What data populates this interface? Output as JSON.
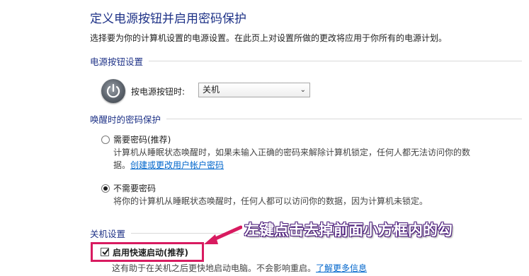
{
  "page": {
    "title": "定义电源按钮并启用密码保护",
    "description": "选择要为你的计算机设置的电源设置。在此页上对设置所做的更改将应用于你所有的电源计划。"
  },
  "power_button_section": {
    "heading": "电源按钮设置",
    "field_label": "按电源按钮时:",
    "selected_value": "关机",
    "icon": "power-icon"
  },
  "password_section": {
    "heading": "唤醒时的密码保护",
    "option_require": {
      "label": "需要密码(推荐)",
      "desc_line1": "计算机从睡眠状态唤醒时，如果未输入正确的密码来解除计算机锁定，任何人都无法访问你的数",
      "desc_line2_prefix": "据。",
      "link": "创建或更改用户帐户密码",
      "checked": false
    },
    "option_no_require": {
      "label": "不需要密码",
      "desc": "将你的计算机从睡眠状态唤醒时，任何人都可以访问你的数据，因为计算机未锁定。",
      "checked": true
    }
  },
  "shutdown_section": {
    "heading": "关机设置",
    "fast_startup": {
      "label": "启用快速启动(推荐)",
      "checked": true,
      "desc": "这有助于在关机之后更快地启动电脑。不会影响重启。",
      "link": "了解更多信息"
    }
  },
  "annotation": {
    "text": "左键点击去掉前面小方框内的勾",
    "color": "#ffffff",
    "outline_color": "#4a1a7a",
    "highlight_color": "#d81b60"
  },
  "colors": {
    "heading": "#1e3287",
    "link": "#0066cc"
  }
}
